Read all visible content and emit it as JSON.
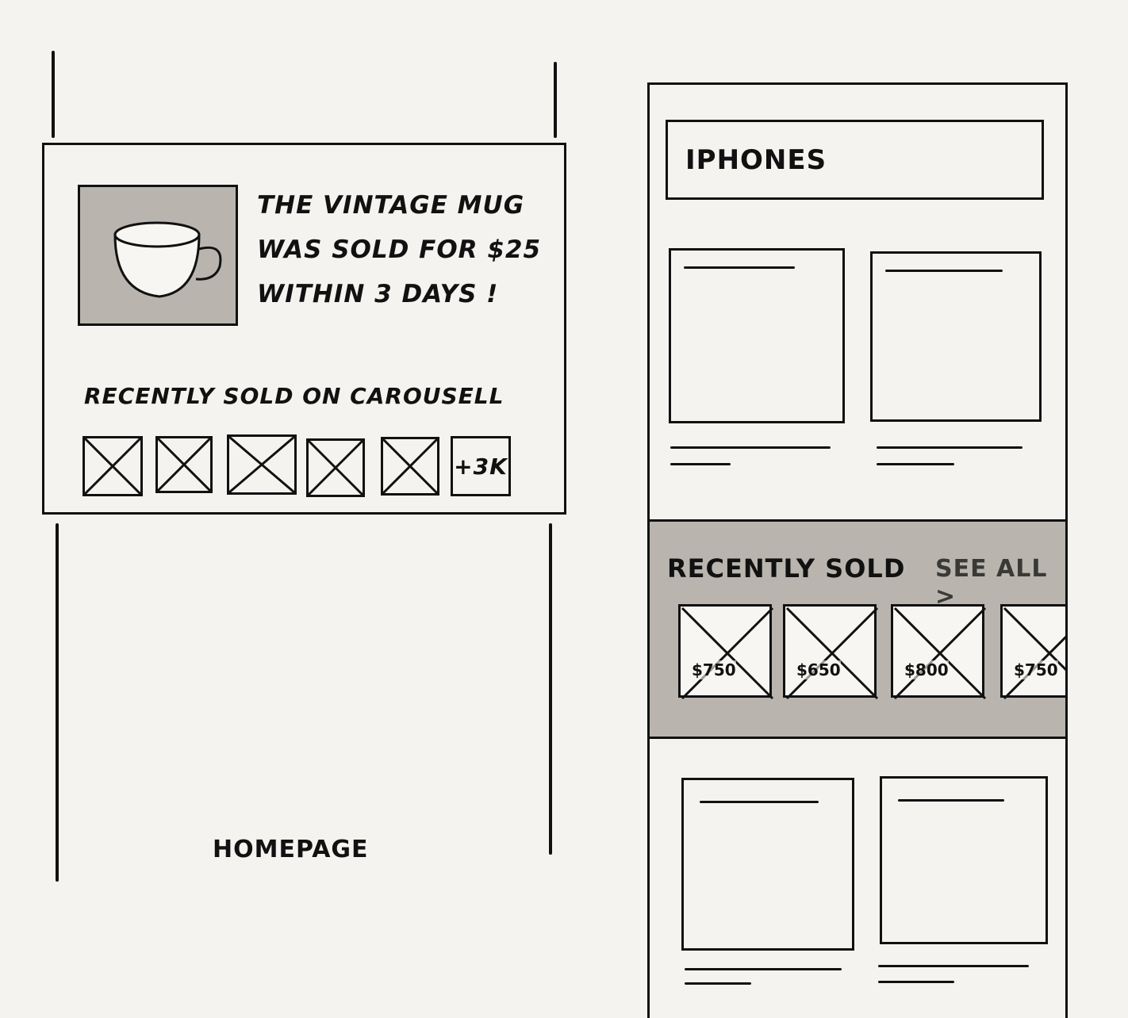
{
  "home": {
    "caption_lines": [
      "THE VINTAGE MUG",
      "WAS SOLD FOR $25",
      "WITHIN 3 DAYS !"
    ],
    "recent_label": "RECENTLY SOLD ON CAROUSELL",
    "more_count": "+3K",
    "label": "HOMEPAGE"
  },
  "category": {
    "search_text": "IPHONES",
    "recently_sold": {
      "title": "RECENTLY SOLD",
      "see_all": "SEE ALL >",
      "prices": [
        "$750",
        "$650",
        "$800",
        "$750"
      ]
    }
  },
  "colors": {
    "ink": "#111111",
    "paper": "#f4f3f0",
    "gray_fill": "#b9b5ae"
  },
  "icons": [
    "mug-icon",
    "image-placeholder-icon",
    "chevron-right-icon"
  ]
}
